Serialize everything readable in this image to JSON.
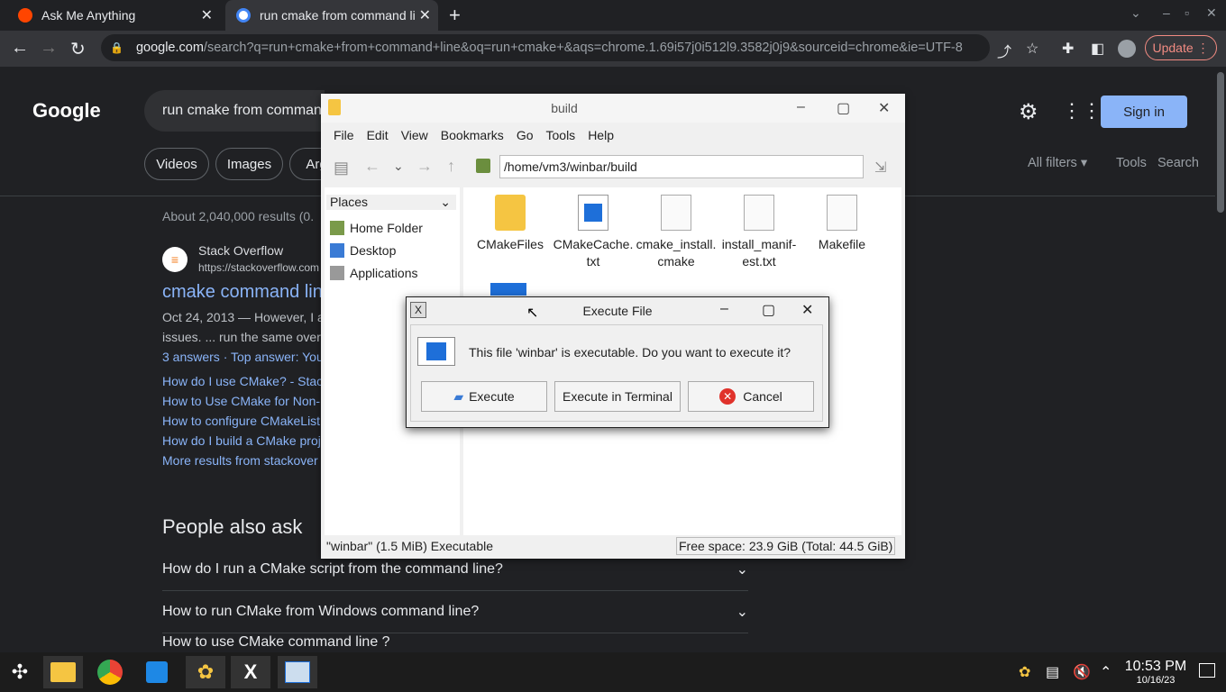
{
  "browser": {
    "tabs": [
      {
        "label": "Ask Me Anything",
        "icon": "reddit-icon"
      },
      {
        "label": "run cmake from command li",
        "icon": "google-icon"
      }
    ],
    "url_host": "google.com",
    "url_rest": "/search?q=run+cmake+from+command+line&oq=run+cmake+&aqs=chrome.1.69i57j0i512l9.3582j0j9&sourceid=chrome&ie=UTF-8",
    "update_label": "Update"
  },
  "google": {
    "logo": "Google",
    "search_value": "run cmake from comman",
    "signin_label": "Sign in",
    "chips": [
      "Videos",
      "Images",
      "Arg"
    ],
    "all_filters": "All filters ▾",
    "tools": "Tools",
    "results_count": "About 2,040,000 results (0.",
    "result": {
      "site": "Stack Overflow",
      "url": "https://stackoverflow.com",
      "title": "cmake command lin",
      "snippet1": "Oct 24, 2013 — However, I ar",
      "snippet2": "issues. ... run the same over",
      "answers": "3 answers · Top answer: You",
      "links": [
        "How do I use CMake? - Stack",
        "How to Use CMake for Non-I",
        "How to configure CMakeList",
        "How do I build a CMake proj",
        "More results from stackover"
      ]
    },
    "paa_title": "People also ask",
    "questions": [
      "How do I run a CMake script from the command line?",
      "How to run CMake from Windows command line?",
      "How to use CMake command line ?"
    ]
  },
  "file_manager": {
    "title": "build",
    "menu": [
      "File",
      "Edit",
      "View",
      "Bookmarks",
      "Go",
      "Tools",
      "Help"
    ],
    "path": "/home/vm3/winbar/build",
    "places_label": "Places",
    "places": [
      "Home Folder",
      "Desktop",
      "Applications"
    ],
    "files": [
      {
        "name": "CMakeFiles",
        "type": "folder"
      },
      {
        "name": "CMakeCache.\ntxt",
        "type": "cache"
      },
      {
        "name": "cmake_install.\ncmake",
        "type": "text"
      },
      {
        "name": "install_manif-\nest.txt",
        "type": "text"
      },
      {
        "name": "Makefile",
        "type": "text"
      }
    ],
    "status_left": "\"winbar\" (1.5 MiB) Executable",
    "status_right": "Free space: 23.9 GiB (Total: 44.5 GiB)"
  },
  "dialog": {
    "title": "Execute File",
    "message": "This file 'winbar' is executable. Do you want to execute it?",
    "execute_label": "Execute",
    "terminal_label": "Execute in Terminal",
    "cancel_label": "Cancel"
  },
  "taskbar": {
    "time": "10:53 PM",
    "date": "10/16/23"
  }
}
